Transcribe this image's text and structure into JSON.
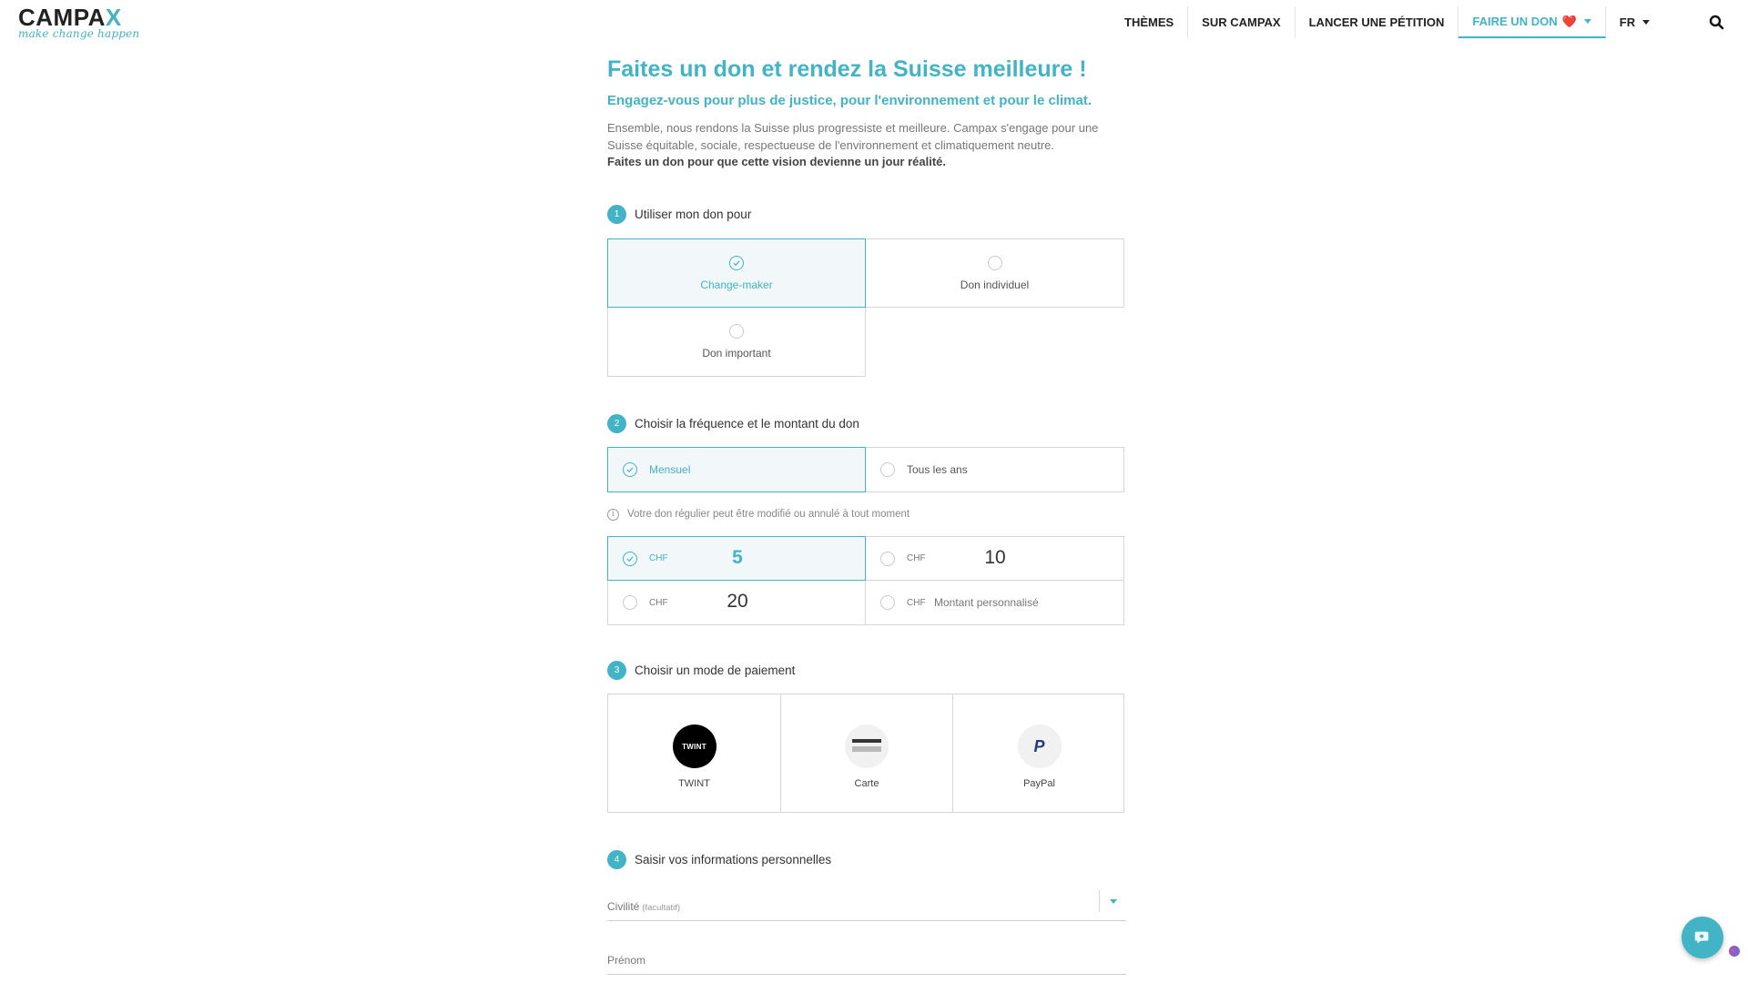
{
  "logo": {
    "name_main": "CAMPA",
    "name_x": "X",
    "tagline": "make change happen"
  },
  "nav": {
    "items": [
      {
        "label": "THÈMES"
      },
      {
        "label": "SUR CAMPAX"
      },
      {
        "label": "LANCER UNE PÉTITION"
      },
      {
        "label": "FAIRE UN DON",
        "active": true,
        "suffix": "❤️"
      },
      {
        "label": "FR"
      }
    ]
  },
  "page": {
    "title": "Faites un don et rendez la Suisse meilleure !",
    "subtitle": "Engagez-vous pour plus de justice, pour l'environnement et pour le climat.",
    "intro": "Ensemble, nous rendons la Suisse plus progressiste et meilleure. Campax s'engage pour une Suisse équitable, sociale, respectueuse de l'environnement et climatiquement neutre.",
    "intro_bold": "Faites un don pour que cette vision devienne un jour réalité."
  },
  "step1": {
    "num": "1",
    "label": "Utiliser mon don pour",
    "options": [
      {
        "label": "Change-maker",
        "selected": true
      },
      {
        "label": "Don individuel",
        "selected": false
      },
      {
        "label": "Don important",
        "selected": false
      }
    ]
  },
  "step2": {
    "num": "2",
    "label": "Choisir la fréquence et le montant du don",
    "frequency": [
      {
        "label": "Mensuel",
        "selected": true
      },
      {
        "label": "Tous les ans",
        "selected": false
      }
    ],
    "info": "Votre don régulier peut être modifié ou annulé à tout moment",
    "info_icon": "i",
    "currency": "CHF",
    "amounts": [
      {
        "value": "5",
        "selected": true
      },
      {
        "value": "10",
        "selected": false
      },
      {
        "value": "20",
        "selected": false
      }
    ],
    "custom_label": "Montant personnalisé"
  },
  "step3": {
    "num": "3",
    "label": "Choisir un mode de paiement",
    "methods": [
      {
        "label": "TWINT",
        "icon_text": "TWINT"
      },
      {
        "label": "Carte"
      },
      {
        "label": "PayPal",
        "icon_text": "P"
      }
    ]
  },
  "step4": {
    "num": "4",
    "label": "Saisir vos informations personnelles",
    "civility_label": "Civilité",
    "civility_optional": "(facultatif)",
    "firstname_label": "Prénom"
  },
  "colors": {
    "accent": "#42b4c5",
    "heart": "#e23a3a",
    "text": "#333333"
  },
  "icons": {
    "search": "search-icon",
    "chat": "chat-icon",
    "check": "check-icon"
  }
}
